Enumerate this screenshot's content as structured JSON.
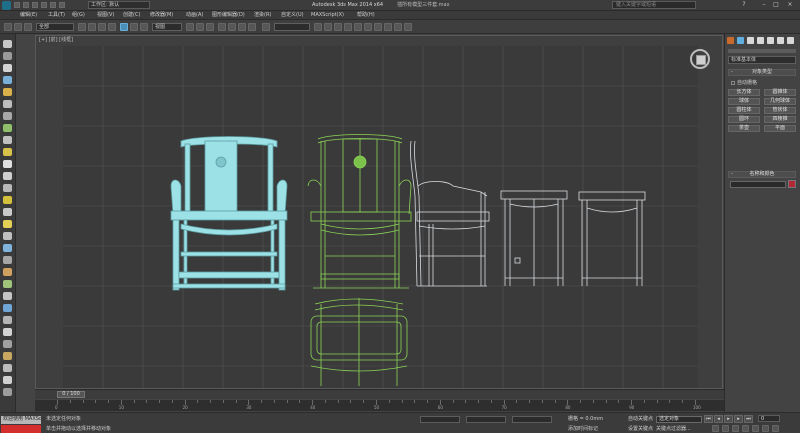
{
  "titlebar": {
    "workspace": "工作区: 默认",
    "app_title": "Autodesk 3ds Max  2014 x64",
    "file_name": "插所有模型三件套.max",
    "search_placeholder": "键入关键字或短语"
  },
  "menu": [
    "编辑(E)",
    "工具(T)",
    "组(G)",
    "视图(V)",
    "创建(C)",
    "修改器(M)",
    "动画(A)",
    "图形编辑器(D)",
    "渲染(R)",
    "自定义(U)",
    "MAXScript(X)",
    "帮助(H)"
  ],
  "toolbar": {
    "selection_filter": "全部",
    "view_dropdown": "视图",
    "selection_set": ""
  },
  "viewport": {
    "label": "[+] [前] [线框]"
  },
  "command_panel": {
    "category": "标准基本体",
    "object_type_title": "对象类型",
    "autogrid_label": "自动栅格",
    "object_buttons": [
      "长方体",
      "圆锥体",
      "球体",
      "几何球体",
      "圆柱体",
      "管状体",
      "圆环",
      "四棱锥",
      "茶壶",
      "平面"
    ],
    "name_color_title": "名称和颜色",
    "rollout_sign": "-",
    "accent_color": "#b02a39"
  },
  "timeline": {
    "frame_display": "0 / 100",
    "ruler_labels": [
      "0",
      "10",
      "20",
      "30",
      "40",
      "50",
      "60",
      "70",
      "80",
      "90",
      "100"
    ]
  },
  "statusbar": {
    "welcome": "欢迎使用 MAXScr",
    "selection_status": "未选定任何对象",
    "prompt": "单击并拖动以选择并移动对象",
    "grid": "栅格 = 0.0mm",
    "add_time_tag": "添加时间标记",
    "auto_key": "自动关键点",
    "set_key": "设置关键点",
    "key_filter_dropdown": "选定对象",
    "key_filters": "关键点过滤器...",
    "frame_value": "0"
  },
  "colors": {
    "selected_object": "#9be1e6",
    "wire_object": "#8bd456",
    "grid_line": "#555555",
    "viewport_bg": "#3a3a3a"
  }
}
